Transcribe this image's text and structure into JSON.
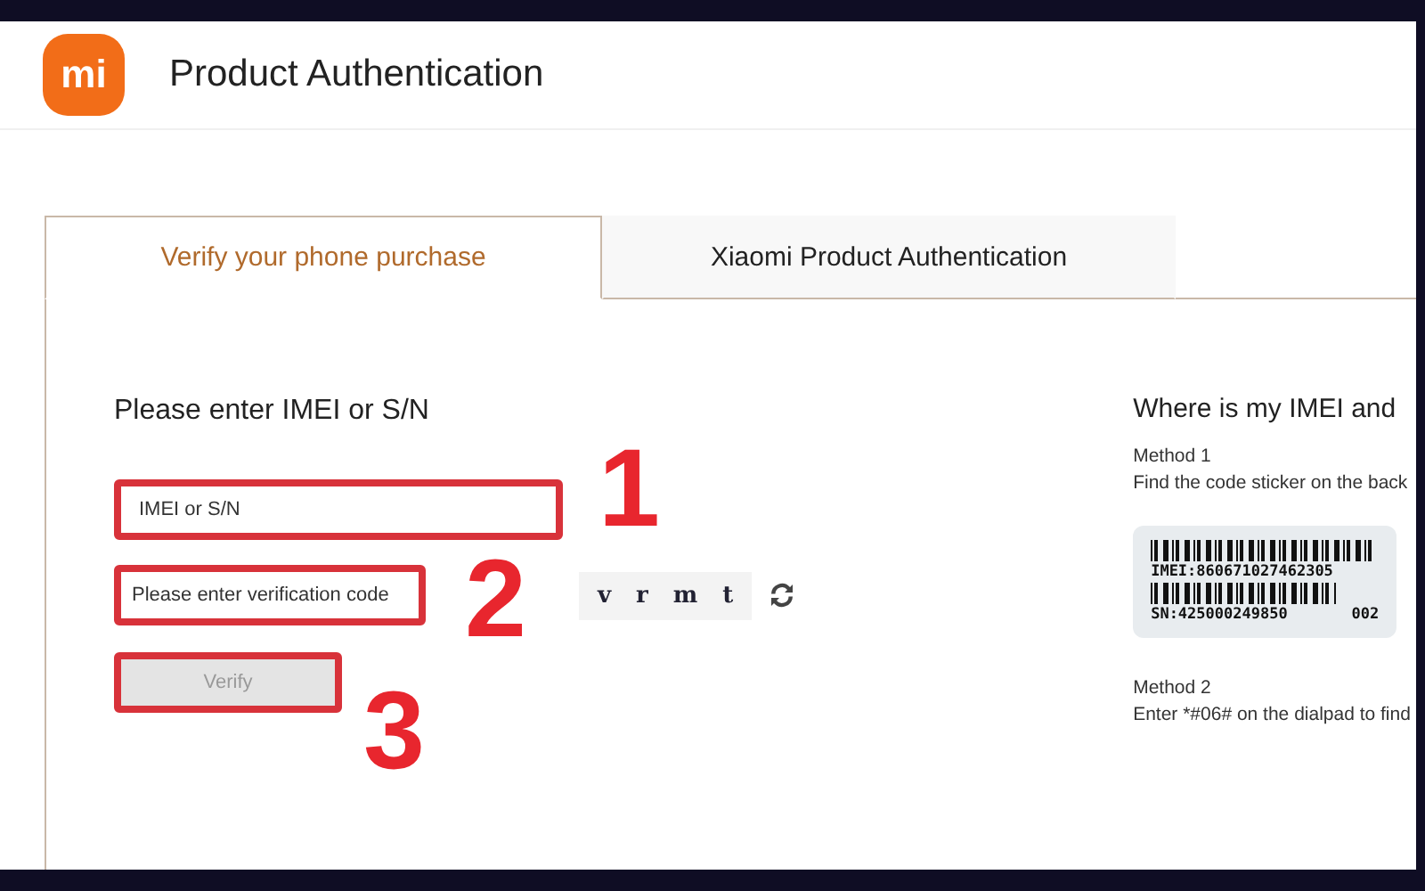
{
  "header": {
    "logo": "mi",
    "title": "Product Authentication"
  },
  "tabs": [
    {
      "label": "Verify your phone purchase",
      "selected": true
    },
    {
      "label": "Xiaomi Product Authentication",
      "selected": false
    }
  ],
  "form": {
    "heading": "Please enter IMEI or S/N",
    "imei_field": {
      "placeholder": "IMEI or S/N",
      "highlighted": true
    },
    "code_field": {
      "placeholder": "Please enter verification code",
      "highlighted": true
    },
    "captcha": [
      "v",
      "r",
      "m",
      "t"
    ],
    "verify_button": {
      "label": "Verify",
      "disabled": true,
      "highlighted": true
    }
  },
  "annotations": [
    "1",
    "2",
    "3"
  ],
  "help": {
    "heading": "Where is my IMEI and",
    "methods": [
      {
        "title": "Method 1",
        "text": "Find the code sticker on the back"
      },
      {
        "title": "Method 2",
        "text": "Enter *#06# on the dialpad to find"
      }
    ],
    "sticker": {
      "imei": "IMEI:860671027462305",
      "sn": "SN:425000249850",
      "code": "002"
    }
  }
}
